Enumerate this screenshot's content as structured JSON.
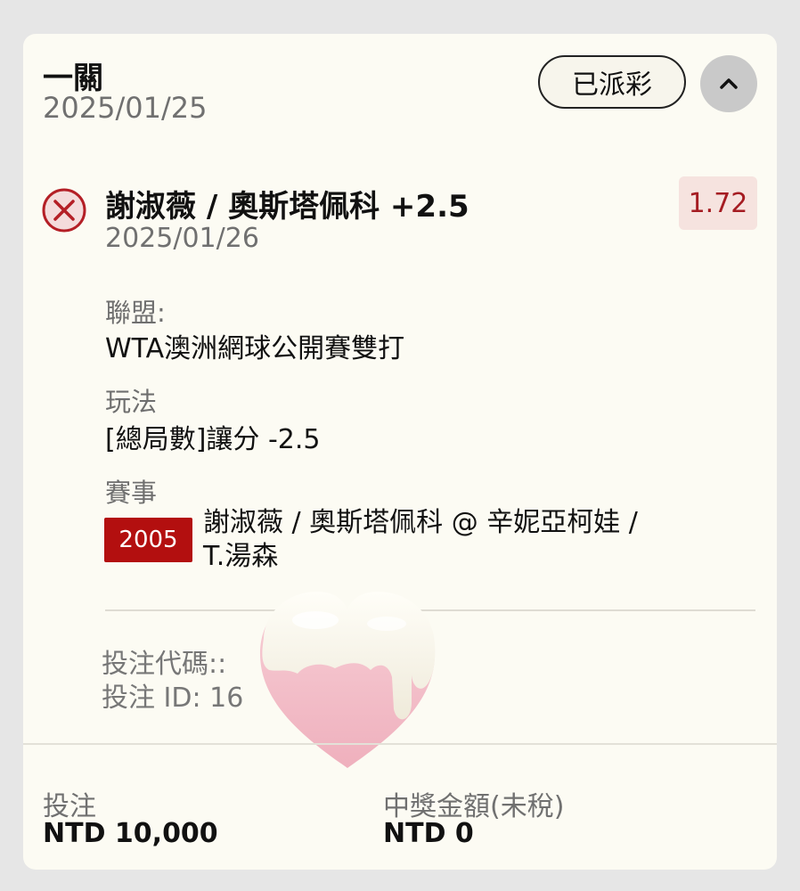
{
  "header": {
    "bet_type": "一關",
    "date": "2025/01/25",
    "status": "已派彩"
  },
  "selection": {
    "title": "謝淑薇 / 奧斯塔佩科 +2.5",
    "date": "2025/01/26",
    "odds": "1.72",
    "result_icon": "x-circle-icon",
    "league_label": "聯盟:",
    "league_value": "WTA澳洲網球公開賽雙打",
    "play_label": "玩法",
    "play_value": "[總局數]讓分 -2.5",
    "match_label": "賽事",
    "match_code": "2005",
    "match_name": "謝淑薇 / 奧斯塔佩科 @ 辛妮亞柯娃 / T.湯森"
  },
  "references": {
    "bet_code": "投注代碼::",
    "bet_id": "投注 ID: 16"
  },
  "footer": {
    "stake_label": "投注",
    "stake_value": "NTD 10,000",
    "payout_label": "中獎金額(未稅)",
    "payout_value": "NTD 0"
  },
  "colors": {
    "card_bg": "#fcfbf3",
    "accent_red": "#b30f0f",
    "odds_red": "#a51c22",
    "odds_bg": "#f6e3df"
  },
  "overlay": {
    "sticker": "heart-sticker"
  }
}
